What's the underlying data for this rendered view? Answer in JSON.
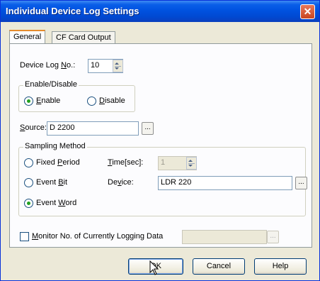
{
  "window": {
    "title": "Individual Device Log Settings",
    "close_glyph": "✕"
  },
  "tabs": [
    {
      "label": "General",
      "active": true
    },
    {
      "label": "CF Card Output",
      "active": false
    }
  ],
  "device_log_no": {
    "label_pre": "Device Log ",
    "label_key": "N",
    "label_post": "o.:",
    "value": "10"
  },
  "enable_group": {
    "title": "Enable/Disable",
    "enable": {
      "key": "E",
      "rest": "nable",
      "checked": true
    },
    "disable": {
      "key": "D",
      "rest": "isable",
      "checked": false
    }
  },
  "source": {
    "label_key": "S",
    "label_rest": "ource:",
    "value": "D 2200",
    "browse": "..."
  },
  "sampling": {
    "title": "Sampling Method",
    "fixed_period": {
      "pre": "Fixed ",
      "key": "P",
      "post": "eriod",
      "checked": false
    },
    "event_bit": {
      "pre": "Event ",
      "key": "B",
      "post": "it",
      "checked": false
    },
    "event_word": {
      "pre": "Event ",
      "key": "W",
      "post": "ord",
      "checked": true
    },
    "time": {
      "label_key": "T",
      "label_rest": "ime[sec]:",
      "value": "1"
    },
    "device": {
      "label_pre": "De",
      "label_key": "v",
      "label_post": "ice:",
      "value": "LDR 220",
      "browse": "..."
    }
  },
  "monitor": {
    "label_key": "M",
    "label_rest": "onitor No. of Currently Logging Data",
    "checked": false,
    "value": "",
    "browse": "..."
  },
  "buttons": {
    "ok": "OK",
    "cancel": "Cancel",
    "help": "Help"
  },
  "colors": {
    "title_bar": "#0052e0",
    "face": "#ece9d8",
    "radio_dot": "#21a121"
  }
}
